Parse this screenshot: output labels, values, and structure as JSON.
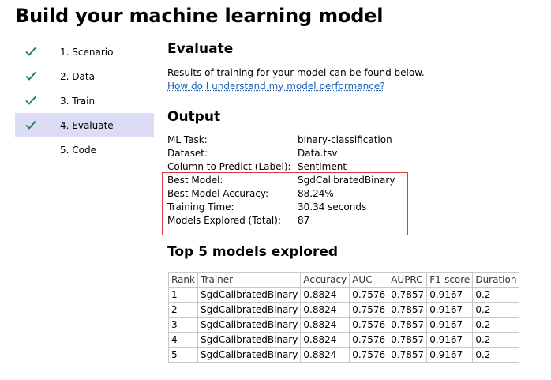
{
  "page": {
    "title": "Build your machine learning model"
  },
  "steps": [
    {
      "label": "1. Scenario",
      "done": true,
      "active": false
    },
    {
      "label": "2. Data",
      "done": true,
      "active": false
    },
    {
      "label": "3. Train",
      "done": true,
      "active": false
    },
    {
      "label": "4. Evaluate",
      "done": true,
      "active": true
    },
    {
      "label": "5. Code",
      "done": false,
      "active": false
    }
  ],
  "evaluate": {
    "heading": "Evaluate",
    "intro": "Results of training for your model can be found below.",
    "help_link": "How do I understand my model performance?"
  },
  "output": {
    "heading": "Output",
    "rows": [
      {
        "key": "ML Task:",
        "value": "binary-classification"
      },
      {
        "key": "Dataset:",
        "value": "Data.tsv"
      },
      {
        "key": "Column to Predict (Label):",
        "value": "Sentiment"
      },
      {
        "key": "Best Model:",
        "value": "SgdCalibratedBinary"
      },
      {
        "key": "Best Model Accuracy:",
        "value": "88.24%"
      },
      {
        "key": "Training Time:",
        "value": "30.34 seconds"
      },
      {
        "key": "Models Explored (Total):",
        "value": "87"
      }
    ]
  },
  "top_models": {
    "heading": "Top 5 models explored",
    "columns": [
      "Rank",
      "Trainer",
      "Accuracy",
      "AUC",
      "AUPRC",
      "F1-score",
      "Duration"
    ],
    "rows": [
      [
        "1",
        "SgdCalibratedBinary",
        "0.8824",
        "0.7576",
        "0.7857",
        "0.9167",
        "0.2"
      ],
      [
        "2",
        "SgdCalibratedBinary",
        "0.8824",
        "0.7576",
        "0.7857",
        "0.9167",
        "0.2"
      ],
      [
        "3",
        "SgdCalibratedBinary",
        "0.8824",
        "0.7576",
        "0.7857",
        "0.9167",
        "0.2"
      ],
      [
        "4",
        "SgdCalibratedBinary",
        "0.8824",
        "0.7576",
        "0.7857",
        "0.9167",
        "0.2"
      ],
      [
        "5",
        "SgdCalibratedBinary",
        "0.8824",
        "0.7576",
        "0.7857",
        "0.9167",
        "0.2"
      ]
    ]
  },
  "colors": {
    "check": "#1e7a34",
    "active_step_bg": "#dcdcf5",
    "link": "#1a5fb4",
    "highlight_border": "#d63a3a"
  }
}
